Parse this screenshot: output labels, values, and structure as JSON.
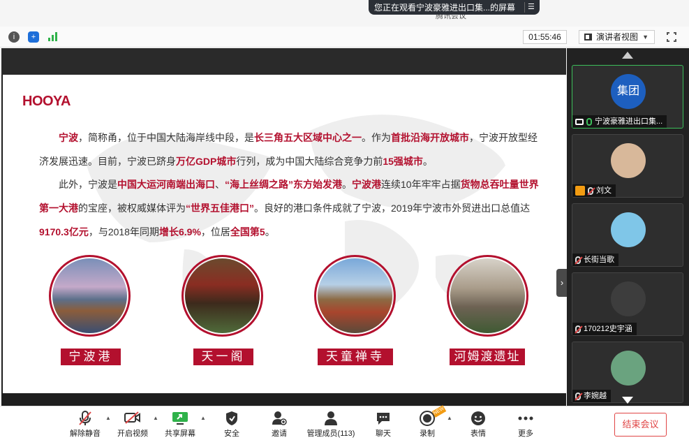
{
  "window": {
    "title": "腾讯会议",
    "share_notice": "您正在观看宁波豪雅进出口集...的屏幕",
    "share_menu_glyph": "☰"
  },
  "toolbar": {
    "timer": "01:55:46",
    "view_mode": "演讲者视图",
    "view_caret": "▼"
  },
  "slide": {
    "logo": "HOOYA",
    "para1": [
      {
        "t": "宁波",
        "b": true
      },
      {
        "t": "，简称甬，位于中国大陆海岸线中段，是",
        "b": false
      },
      {
        "t": "长三角五大区域中心之一",
        "b": true
      },
      {
        "t": "。作为",
        "b": false
      },
      {
        "t": "首批沿海开放城市",
        "b": true
      },
      {
        "t": "，宁波开放型经济发展迅速。目前，宁波已跻身",
        "b": false
      },
      {
        "t": "万亿GDP城市",
        "b": true
      },
      {
        "t": "行列，成为中国大陆综合竞争力前",
        "b": false
      },
      {
        "t": "15强城市",
        "b": true
      },
      {
        "t": "。",
        "b": false
      }
    ],
    "para2": [
      {
        "t": "此外，宁波是",
        "b": false
      },
      {
        "t": "中国大运河南端出海口",
        "b": true
      },
      {
        "t": "、",
        "b": false
      },
      {
        "t": "“海上丝绸之路”东方始发港",
        "b": true
      },
      {
        "t": "。",
        "b": false
      },
      {
        "t": "宁波港",
        "b": true
      },
      {
        "t": "连续10年牢牢占据",
        "b": false
      },
      {
        "t": "货物总吞吐量世界第一大港",
        "b": true
      },
      {
        "t": "的宝座，被权威媒体评为",
        "b": false
      },
      {
        "t": "“世界五佳港口”",
        "b": true
      },
      {
        "t": "。良好的港口条件成就了宁波，2019年宁波市外贸进出口总值达",
        "b": false
      },
      {
        "t": "9170.3亿元",
        "b": true
      },
      {
        "t": "，与2018年同期",
        "b": false
      },
      {
        "t": "增长6.9%",
        "b": true
      },
      {
        "t": "，位居",
        "b": false
      },
      {
        "t": "全国第5",
        "b": true
      },
      {
        "t": "。",
        "b": false
      }
    ],
    "captions": [
      "宁波港",
      "天一阁",
      "天童禅寺",
      "河姆渡遗址"
    ],
    "side_arrow": "›"
  },
  "participants": [
    {
      "avatar_text": "集团",
      "name": "宁波豪雅进出口集...",
      "avatar_color": "#1d5fbf",
      "muted": false,
      "sharing": true
    },
    {
      "avatar_text": "",
      "name": "刘文",
      "avatar_color": "#d8b89a",
      "muted": true,
      "host": true
    },
    {
      "avatar_text": "",
      "name": "长街当歌",
      "avatar_color": "#7fc6e8",
      "muted": true
    },
    {
      "avatar_text": "",
      "name": "170212史宇涵",
      "avatar_color": "#3d3d3d",
      "muted": true
    },
    {
      "avatar_text": "",
      "name": "李婉越",
      "avatar_color": "#6aa37f",
      "muted": true
    }
  ],
  "controls": {
    "unmute": "解除静音",
    "video": "开启视频",
    "share": "共享屏幕",
    "security": "安全",
    "invite": "邀请",
    "members": "管理成员(113)",
    "chat": "聊天",
    "record": "录制",
    "record_badge": "NEW",
    "reactions": "表情",
    "more": "更多",
    "end": "结束会议"
  },
  "colors": {
    "accent_red": "#b3102e",
    "active_green": "#3cbf5a",
    "end_red": "#e04545"
  }
}
